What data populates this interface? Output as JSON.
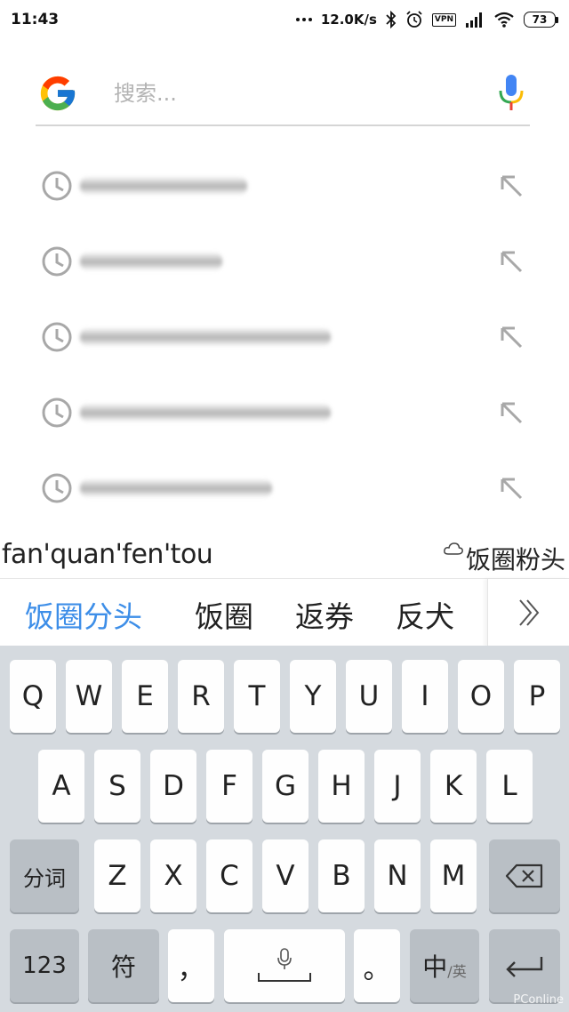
{
  "status_bar": {
    "time": "11:43",
    "net_speed": "12.0K/s",
    "vpn": "VPN",
    "battery": "73"
  },
  "search": {
    "placeholder": "搜索..."
  },
  "history_count": 5,
  "ime": {
    "composition": "fan'quan'fen'tou",
    "cloud_candidate": "饭圈粉头",
    "candidates": [
      "饭圈分头",
      "饭圈",
      "返券",
      "反犬"
    ]
  },
  "keyboard": {
    "row1": [
      "Q",
      "W",
      "E",
      "R",
      "T",
      "Y",
      "U",
      "I",
      "O",
      "P"
    ],
    "row2": [
      "A",
      "S",
      "D",
      "F",
      "G",
      "H",
      "J",
      "K",
      "L"
    ],
    "row3_left": "分词",
    "row3": [
      "Z",
      "X",
      "C",
      "V",
      "B",
      "N",
      "M"
    ],
    "row4": {
      "numbers": "123",
      "symbols": "符",
      "comma": "，",
      "period": "。",
      "lang_main": "中",
      "lang_sub": "/英"
    }
  },
  "watermark": "PConline",
  "colors": {
    "accent": "#3d8ee8",
    "keyboard_bg": "#d5dadf",
    "fn_key": "#b9bfc5"
  }
}
